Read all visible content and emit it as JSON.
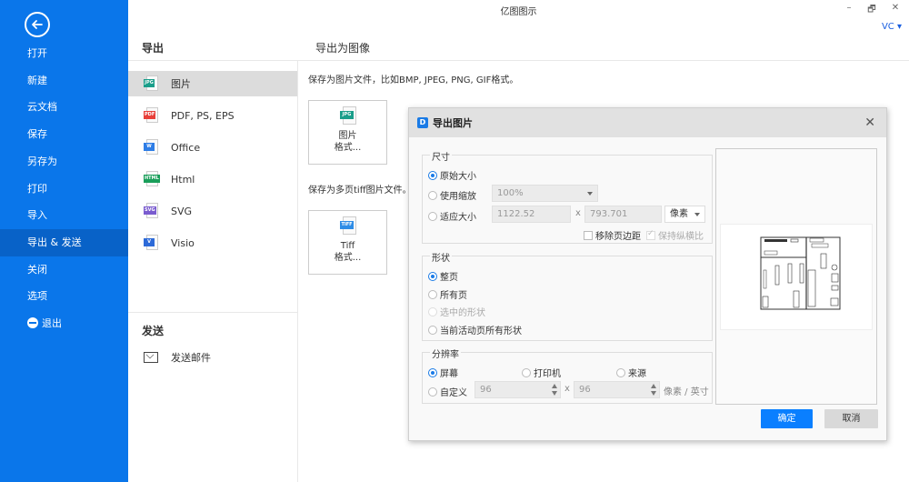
{
  "app": {
    "title": "亿图图示",
    "user": "VC ▾",
    "window_controls": {
      "minimize": "–",
      "restore": "🗗",
      "close": "✕"
    }
  },
  "sidebar": {
    "back_icon": "arrow-left-circle-icon",
    "items": [
      {
        "label": "打开"
      },
      {
        "label": "新建"
      },
      {
        "label": "云文档"
      },
      {
        "label": "保存"
      },
      {
        "label": "另存为"
      },
      {
        "label": "打印"
      },
      {
        "label": "导入"
      },
      {
        "label": "导出 & 发送",
        "active": true
      },
      {
        "label": "关闭"
      },
      {
        "label": "选项"
      },
      {
        "label": "退出",
        "icon": "minus-circle-icon"
      }
    ]
  },
  "export_panel": {
    "heading": "导出",
    "formats": [
      {
        "label": "图片",
        "tag": "JPG",
        "color": "#1a9e8a",
        "active": true
      },
      {
        "label": "PDF, PS, EPS",
        "tag": "PDF",
        "color": "#e8403a"
      },
      {
        "label": "Office",
        "tag": "W",
        "color": "#2e7de6"
      },
      {
        "label": "Html",
        "tag": "HTML",
        "color": "#1a9e5a"
      },
      {
        "label": "SVG",
        "tag": "SVG",
        "color": "#7a5ccf"
      },
      {
        "label": "Visio",
        "tag": "V",
        "color": "#2d6ad8"
      }
    ],
    "send_heading": "发送",
    "send_items": [
      {
        "label": "发送邮件",
        "icon": "mail-send-icon"
      }
    ]
  },
  "right_panel": {
    "heading": "导出为图像",
    "image_desc": "保存为图片文件，比如BMP, JPEG, PNG, GIF格式。",
    "image_button": {
      "line1": "图片",
      "line2": "格式...",
      "tag": "JPG",
      "color": "#1a9e8a"
    },
    "tiff_desc": "保存为多页tiff图片文件。",
    "tiff_button": {
      "line1": "Tiff",
      "line2": "格式...",
      "tag": "TIFF",
      "color": "#2e8ce6"
    }
  },
  "dialog": {
    "title": "导出图片",
    "close": "✕",
    "size_group": {
      "label": "尺寸",
      "options": [
        {
          "label": "原始大小",
          "checked": true
        },
        {
          "label": "使用缩放",
          "checked": false
        },
        {
          "label": "适应大小",
          "checked": false
        }
      ],
      "zoom_value": "100%",
      "width_value": "1122.52",
      "height_value": "793.701",
      "times": "x",
      "unit": "像素",
      "remove_margin": {
        "label": "移除页边距",
        "checked": false
      },
      "keep_ratio": {
        "label": "保持纵横比",
        "checked": true,
        "disabled": true
      }
    },
    "shape_group": {
      "label": "形状",
      "options": [
        {
          "label": "整页",
          "checked": true
        },
        {
          "label": "所有页",
          "checked": false
        },
        {
          "label": "选中的形状",
          "checked": false,
          "disabled": true
        },
        {
          "label": "当前活动页所有形状",
          "checked": false
        }
      ]
    },
    "resolution_group": {
      "label": "分辨率",
      "options": [
        {
          "label": "屏幕",
          "checked": true
        },
        {
          "label": "打印机",
          "checked": false
        },
        {
          "label": "来源",
          "checked": false
        },
        {
          "label": "自定义",
          "checked": false
        }
      ],
      "x_value": "96",
      "y_value": "96",
      "times": "x",
      "unit": "像素 / 英寸"
    },
    "ok_label": "确定",
    "cancel_label": "取消"
  }
}
